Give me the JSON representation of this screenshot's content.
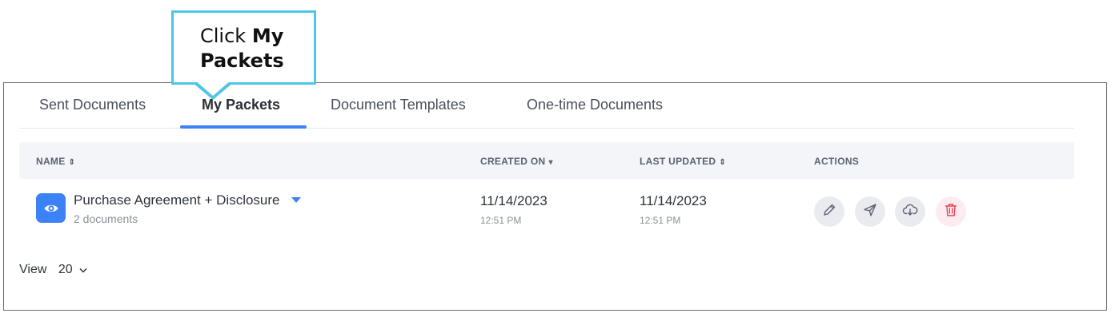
{
  "callout": {
    "prefix": "Click ",
    "strong_line1": "My",
    "strong_line2": "Packets"
  },
  "tabs": [
    {
      "label": "Sent Documents"
    },
    {
      "label": "My Packets",
      "active": true
    },
    {
      "label": "Document Templates"
    },
    {
      "label": "One-time Documents"
    }
  ],
  "table": {
    "headers": {
      "name": "NAME",
      "created_on": "CREATED ON",
      "last_updated": "LAST UPDATED",
      "actions": "ACTIONS"
    },
    "sort_icons": {
      "name": "⇕",
      "created_on": "▾",
      "last_updated": "⇕"
    },
    "rows": [
      {
        "title": "Purchase Agreement + Disclosure",
        "subtitle": "2 documents",
        "created_date": "11/14/2023",
        "created_time": "12:51 PM",
        "updated_date": "11/14/2023",
        "updated_time": "12:51 PM",
        "icons": [
          "eye-icon",
          "pencil-icon",
          "send-icon",
          "cloud-download-icon",
          "trash-icon"
        ]
      }
    ]
  },
  "footer": {
    "view_label": "View",
    "page_size": "20"
  },
  "colors": {
    "accent": "#3b82f6",
    "callout_border": "#4ec6e8",
    "delete": "#e8445a"
  }
}
